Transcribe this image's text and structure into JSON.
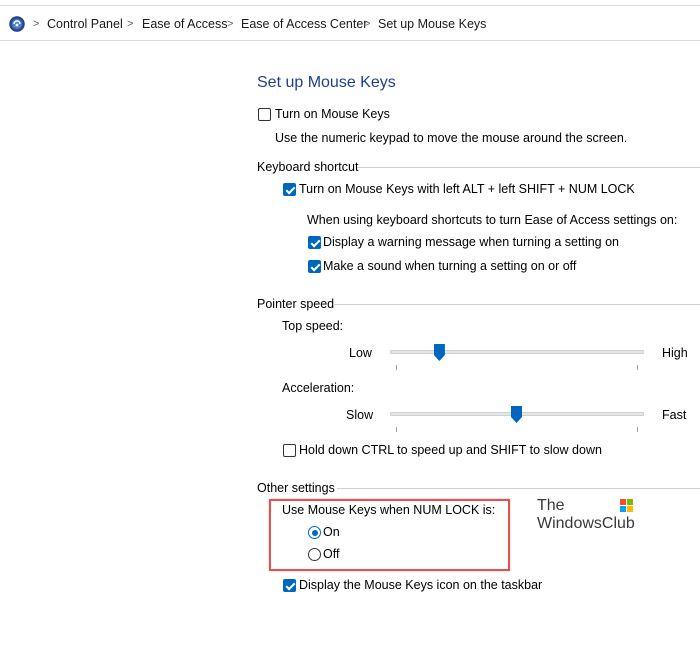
{
  "breadcrumb": {
    "items": [
      "Control Panel",
      "Ease of Access",
      "Ease of Access Center",
      "Set up Mouse Keys"
    ],
    "separator": ">"
  },
  "page": {
    "title": "Set up Mouse Keys"
  },
  "main": {
    "turn_on": {
      "label": "Turn on Mouse Keys",
      "checked": false
    },
    "description": "Use the numeric keypad to move the mouse around the screen."
  },
  "keyboard_shortcut": {
    "header": "Keyboard shortcut",
    "shortcut": {
      "label": "Turn on Mouse Keys with left ALT + left SHIFT + NUM LOCK",
      "checked": true
    },
    "note": "When using keyboard shortcuts to turn Ease of Access settings on:",
    "warning": {
      "label": "Display a warning message when turning a setting on",
      "checked": true
    },
    "sound": {
      "label": "Make a sound when turning a setting on or off",
      "checked": true
    }
  },
  "pointer_speed": {
    "header": "Pointer speed",
    "top_speed": {
      "label": "Top speed:",
      "min_label": "Low",
      "max_label": "High",
      "value": 0.18
    },
    "acceleration": {
      "label": "Acceleration:",
      "min_label": "Slow",
      "max_label": "Fast",
      "value": 0.5
    },
    "ctrl_shift": {
      "label": "Hold down CTRL to speed up and SHIFT to slow down",
      "checked": false
    }
  },
  "other_settings": {
    "header": "Other settings",
    "numlock_label": "Use Mouse Keys when NUM LOCK is:",
    "options": [
      {
        "label": "On",
        "checked": true
      },
      {
        "label": "Off",
        "checked": false
      }
    ],
    "taskbar_icon": {
      "label": "Display the Mouse Keys icon on the taskbar",
      "checked": true
    }
  },
  "watermark": {
    "line1": "The",
    "line2": "WindowsClub"
  },
  "colors": {
    "accent": "#0067c0",
    "title": "#1e3f8f",
    "highlight": "#e05252"
  }
}
